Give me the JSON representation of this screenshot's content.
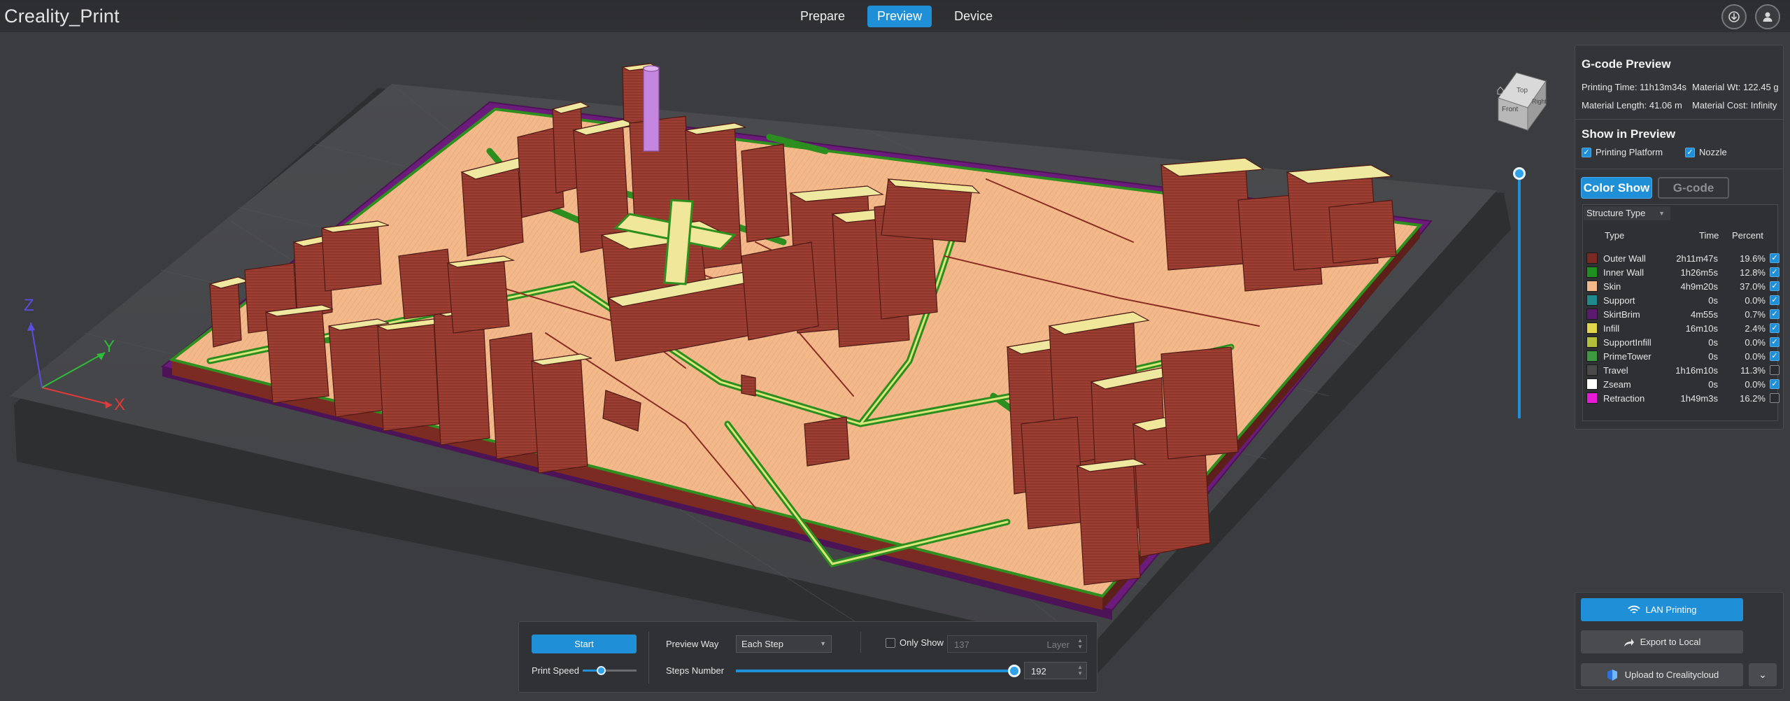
{
  "app": {
    "title": "Creality_Print"
  },
  "modes": [
    {
      "label": "Prepare",
      "active": false
    },
    {
      "label": "Preview",
      "active": true
    },
    {
      "label": "Device",
      "active": false
    }
  ],
  "top_icons": [
    "download-icon",
    "user-icon"
  ],
  "axes": {
    "x": "X",
    "y": "Y",
    "z": "Z"
  },
  "view_cube": {
    "front": "Front",
    "top": "Top",
    "right": "Right"
  },
  "gcode_preview": {
    "title": "G-code Preview",
    "printing_time": "Printing Time: 11h13m34s",
    "material_weight": "Material Wt: 122.45 g",
    "material_length": "Material Length: 41.06 m",
    "material_cost": "Material Cost: Infinity"
  },
  "show_in_preview": {
    "title": "Show in Preview",
    "printing_platform": {
      "label": "Printing Platform",
      "checked": true
    },
    "nozzle": {
      "label": "Nozzle",
      "checked": true
    }
  },
  "view_toggle": {
    "color_show": "Color Show",
    "gcode": "G-code"
  },
  "structure": {
    "dropdown": "Structure Type",
    "headers": {
      "type": "Type",
      "time": "Time",
      "percent": "Percent"
    },
    "rows": [
      {
        "name": "Outer Wall",
        "time": "2h11m47s",
        "percent": "19.6%",
        "color": "#7a2a22",
        "checked": true
      },
      {
        "name": "Inner Wall",
        "time": "1h26m5s",
        "percent": "12.8%",
        "color": "#1f8f1f",
        "checked": true
      },
      {
        "name": "Skin",
        "time": "4h9m20s",
        "percent": "37.0%",
        "color": "#f4b98a",
        "checked": true
      },
      {
        "name": "Support",
        "time": "0s",
        "percent": "0.0%",
        "color": "#1f8a8c",
        "checked": true
      },
      {
        "name": "SkirtBrim",
        "time": "4m55s",
        "percent": "0.7%",
        "color": "#5a1a6e",
        "checked": true
      },
      {
        "name": "Infill",
        "time": "16m10s",
        "percent": "2.4%",
        "color": "#e0d84a",
        "checked": true
      },
      {
        "name": "SupportInfill",
        "time": "0s",
        "percent": "0.0%",
        "color": "#b5c03a",
        "checked": true
      },
      {
        "name": "PrimeTower",
        "time": "0s",
        "percent": "0.0%",
        "color": "#3e9a3e",
        "checked": true
      },
      {
        "name": "Travel",
        "time": "1h16m10s",
        "percent": "11.3%",
        "color": "#4a4a4a",
        "checked": false
      },
      {
        "name": "Zseam",
        "time": "0s",
        "percent": "0.0%",
        "color": "#ffffff",
        "checked": true
      },
      {
        "name": "Retraction",
        "time": "1h49m3s",
        "percent": "16.2%",
        "color": "#e81ad7",
        "checked": false
      }
    ]
  },
  "actions": {
    "lan": "LAN Printing",
    "export": "Export to Local",
    "upload": "Upload to Crealitycloud"
  },
  "playback": {
    "start": "Start",
    "print_speed": "Print Speed",
    "preview_way_label": "Preview Way",
    "preview_way_value": "Each Step",
    "only_show": "Only Show",
    "only_show_checked": false,
    "layer_value": "137",
    "layer_unit": "Layer",
    "steps_label": "Steps Number",
    "steps_value": "192"
  },
  "colors": {
    "accent": "#1f8fd8",
    "background": "#3b3c3f",
    "panel": "#333437"
  }
}
